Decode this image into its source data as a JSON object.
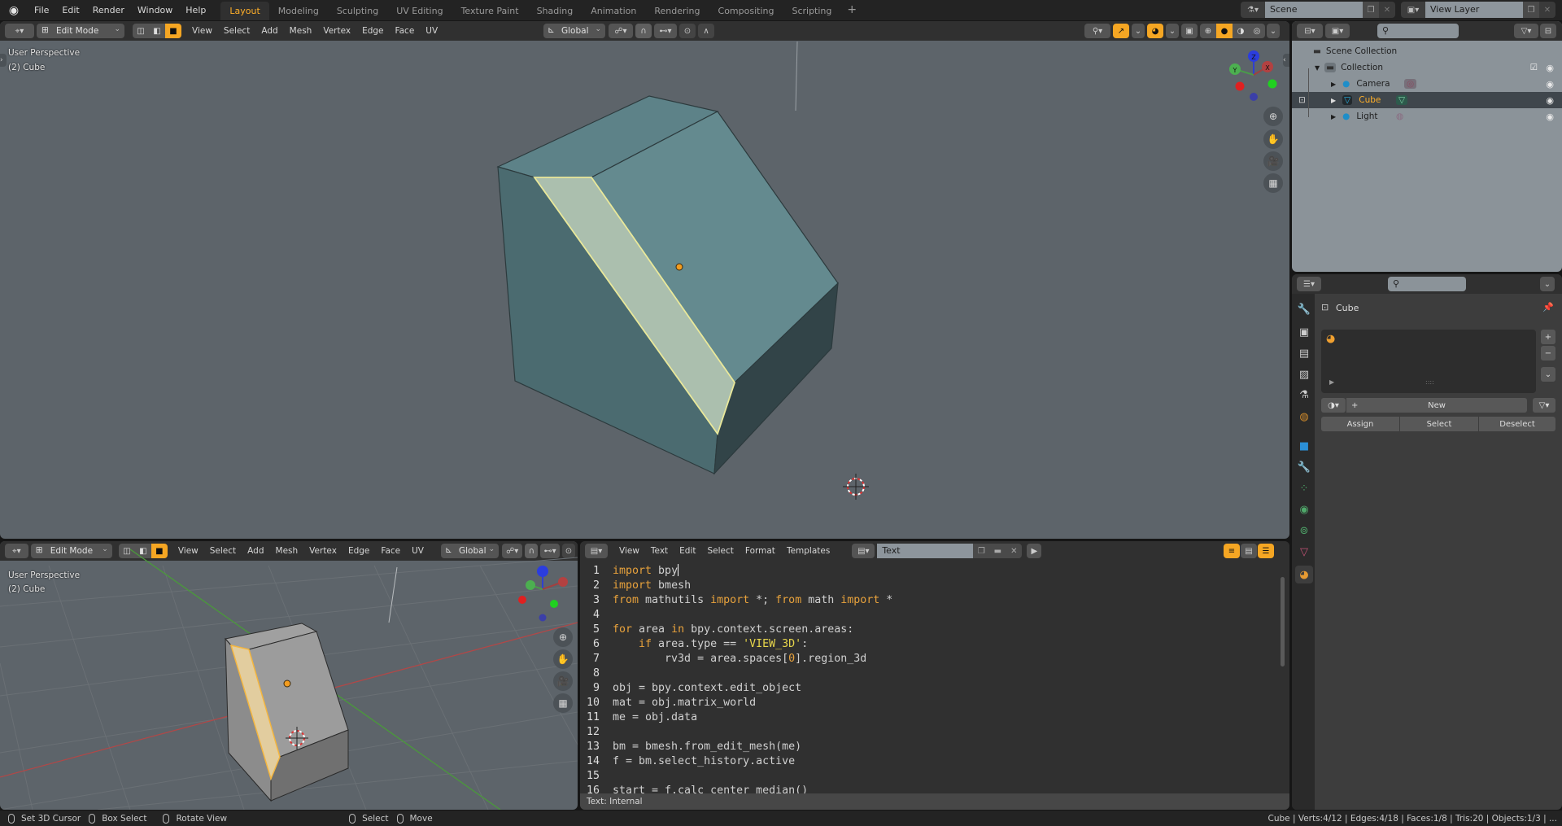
{
  "topbar": {
    "menus": [
      "File",
      "Edit",
      "Render",
      "Window",
      "Help"
    ],
    "workspaces": [
      "Layout",
      "Modeling",
      "Sculpting",
      "UV Editing",
      "Texture Paint",
      "Shading",
      "Animation",
      "Rendering",
      "Compositing",
      "Scripting"
    ],
    "active_workspace": "Layout",
    "scene": "Scene",
    "view_layer": "View Layer"
  },
  "viewport_top": {
    "mode": "Edit Mode",
    "menus": [
      "View",
      "Select",
      "Add",
      "Mesh",
      "Vertex",
      "Edge",
      "Face",
      "UV"
    ],
    "orientation": "Global",
    "overlay_line1": "User Perspective",
    "overlay_line2": "(2) Cube",
    "gizmo_labels": {
      "x": "X",
      "y": "Y",
      "z": "Z"
    }
  },
  "viewport_bottom": {
    "mode": "Edit Mode",
    "menus": [
      "View",
      "Select",
      "Add",
      "Mesh",
      "Vertex",
      "Edge",
      "Face",
      "UV"
    ],
    "orientation": "Global",
    "overlay_line1": "User Perspective",
    "overlay_line2": "(2) Cube"
  },
  "text_editor": {
    "menus": [
      "View",
      "Text",
      "Edit",
      "Select",
      "Format",
      "Templates"
    ],
    "datablock_name": "Text",
    "footer": "Text: Internal",
    "lines": [
      {
        "n": "1",
        "tokens": [
          [
            "kw",
            "import"
          ],
          [
            "",
            "  bpy"
          ]
        ]
      },
      {
        "n": "2",
        "tokens": [
          [
            "kw",
            "import"
          ],
          [
            "",
            "  bmesh"
          ]
        ]
      },
      {
        "n": "3",
        "tokens": [
          [
            "kw",
            "from"
          ],
          [
            "",
            " mathutils "
          ],
          [
            "kw",
            "import"
          ],
          [
            "",
            " *; "
          ],
          [
            "kw",
            "from"
          ],
          [
            "",
            " math "
          ],
          [
            "kw",
            "import"
          ],
          [
            "",
            " *"
          ]
        ]
      },
      {
        "n": "4",
        "tokens": []
      },
      {
        "n": "5",
        "tokens": [
          [
            "kw",
            "for"
          ],
          [
            "",
            " area "
          ],
          [
            "kw",
            "in"
          ],
          [
            "",
            " bpy.context.screen.areas:"
          ]
        ]
      },
      {
        "n": "6",
        "tokens": [
          [
            "",
            "    "
          ],
          [
            "kw",
            "if"
          ],
          [
            "",
            " area.type == "
          ],
          [
            "st",
            "'VIEW_3D'"
          ],
          [
            "",
            ":"
          ]
        ]
      },
      {
        "n": "7",
        "tokens": [
          [
            "",
            "        rv3d = area.spaces["
          ],
          [
            "nm",
            "0"
          ],
          [
            "",
            "].region_3d"
          ]
        ]
      },
      {
        "n": "8",
        "tokens": []
      },
      {
        "n": "9",
        "tokens": [
          [
            "",
            "obj = bpy.context.edit_object"
          ]
        ]
      },
      {
        "n": "10",
        "tokens": [
          [
            "",
            "mat = obj.matrix_world"
          ]
        ]
      },
      {
        "n": "11",
        "tokens": [
          [
            "",
            "me = obj.data"
          ]
        ]
      },
      {
        "n": "12",
        "tokens": []
      },
      {
        "n": "13",
        "tokens": [
          [
            "",
            "bm = bmesh.from_edit_mesh(me)"
          ]
        ]
      },
      {
        "n": "14",
        "tokens": [
          [
            "",
            "f = bm.select_history.active"
          ]
        ]
      },
      {
        "n": "15",
        "tokens": []
      },
      {
        "n": "16",
        "tokens": [
          [
            "",
            "start = f.calc_center_median()"
          ]
        ]
      }
    ]
  },
  "outliner": {
    "root": "Scene Collection",
    "collection": "Collection",
    "items": [
      {
        "name": "Camera",
        "selected": false
      },
      {
        "name": "Cube",
        "selected": true
      },
      {
        "name": "Light",
        "selected": false
      }
    ]
  },
  "properties": {
    "object_name": "Cube",
    "new_label": "New",
    "assign_label": "Assign",
    "select_label": "Select",
    "deselect_label": "Deselect"
  },
  "statusbar": {
    "left": [
      "Set 3D Cursor",
      "Box Select",
      "Rotate View"
    ],
    "middle": [
      "Select",
      "Move"
    ],
    "stats": "Cube | Verts:4/12 | Edges:4/18 | Faces:1/8 | Tris:20 | Objects:1/3 | ..."
  },
  "colors": {
    "accent": "#f5a623",
    "active_text": "#ffaf29",
    "viewport_bg": "#5d646a",
    "selected_face": "#aebfae"
  }
}
